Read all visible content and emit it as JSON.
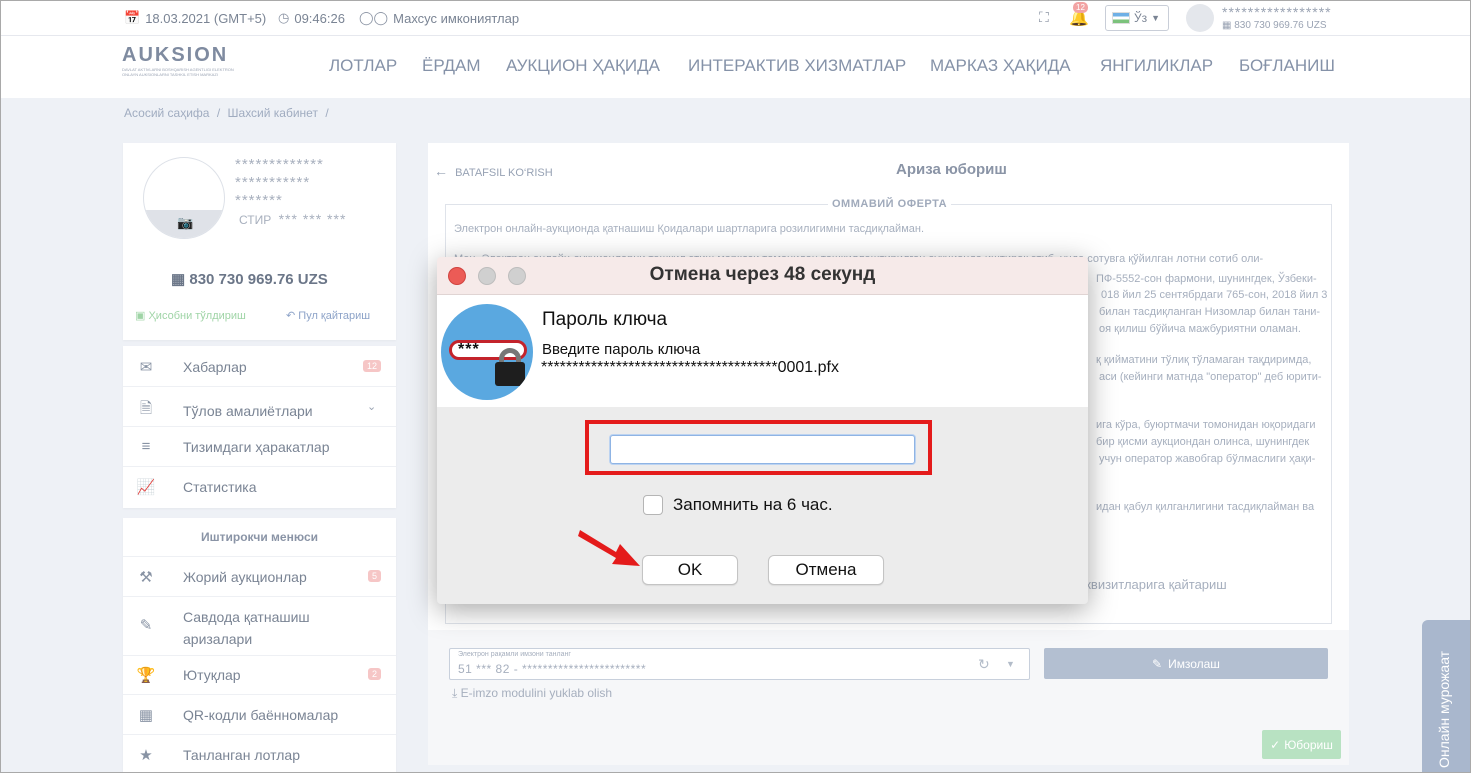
{
  "topbar": {
    "date": "18.03.2021 (GMT+5)",
    "time": "09:46:26",
    "accessibility": "Махсус имкониятлар",
    "notifications_count": "12",
    "language": "Ўз",
    "user_name": "*****************",
    "user_balance": "830 730 969.76 UZS"
  },
  "logo": {
    "text": "AUKSION",
    "subtitle": "DAVLAT AKTIVLARNI BOSHQARISH AGENTLIGI ELEKTRON ONLAYN AUKSIONLARNI TASHKIL ETISH MARKAZI"
  },
  "nav": {
    "items": [
      "ЛОТЛАР",
      "ЁРДАМ",
      "АУКЦИОН ҲАҚИДА",
      "ИНТЕРАКТИВ ХИЗМАТЛАР",
      "МАРКАЗ ҲАҚИДА",
      "ЯНГИЛИКЛАР",
      "БОҒЛАНИШ"
    ]
  },
  "breadcrumb": {
    "home": "Асосий саҳифа",
    "current": "Шахсий кабинет",
    "sep": "/"
  },
  "profile": {
    "name_line1": "*************",
    "name_line2": "***********",
    "name_line3": "*******",
    "stir_label": "СТИР",
    "stir_value": "*** *** ***",
    "balance": "830 730 969.76 UZS",
    "topup_label": "Ҳисобни тўлдириш",
    "refund_label": "Пул қайтариш"
  },
  "sidebar": {
    "items": [
      {
        "label": "Хабарлар",
        "badge": "12"
      },
      {
        "label": "Тўлов амалиётлари"
      },
      {
        "label": "Тизимдаги ҳаракатлар"
      },
      {
        "label": "Статистика"
      }
    ],
    "participant_menu_title": "Иштирокчи менюси",
    "participant_items": [
      {
        "label": "Жорий аукционлар",
        "badge": "5"
      },
      {
        "label_line1": "Савдода қатнашиш",
        "label_line2": "аризалари"
      },
      {
        "label": "Ютуқлар",
        "badge": "2"
      },
      {
        "label": "QR-кодли баённомалар"
      },
      {
        "label": "Танланган лотлар"
      }
    ]
  },
  "main": {
    "back_label": "BATAFSIL KO‘RISH",
    "title": "Ариза юбориш",
    "offer_heading": "ОММАВИЙ ОФЕРТА",
    "offer_lines": [
      "Электрон онлайн-аукционда қатнашиш Қоидалари шартларига розилигимни тасдиқлайман.",
      "Мен, Электрон онлайн-аукционларни ташкил этиш маркази томонидан ташкиллаштирилган аукционда иштирок этиб, унда сотувга қўйилган лотни сотиб оли-",
      "ПФ-5552-сон фармони, шунингдек, Ўзбеки-",
      "018 йил 25 сентябрдаги 765-сон, 2018 йил 3",
      "билан тасдиқланган Низомлар билан тани-",
      "оя қилиш бўйича мажбуриятни оламан.",
      "қ қийматини тўлиқ тўламаган тақдиримда,",
      "аси (кейинги матнда \"оператор\" деб юрити-",
      "ига кўра, буюртмачи томонидан юқоридаги",
      "бир қисми аукциондан олинса, шунингдек",
      "учун оператор жавобгар бўлмаслиги ҳақи-",
      "идан қабул қилганлигини тасдиқлайман ва",
      "еквизитларига қайтариш"
    ],
    "sign_label": "Электрон рақамли имзони танланг",
    "sign_value": "51 *** 82 -   ************************",
    "sign_button": "Имзолаш",
    "eimzo_link": "E-imzo modulini yuklab olish",
    "send_button": "Юбориш"
  },
  "side_tab": {
    "label": "Онлайн мурожаат"
  },
  "dialog": {
    "title": "Отмена через 48 секунд",
    "heading": "Пароль ключа",
    "prompt": "Введите пароль ключа",
    "key_file": "**************************************0001.pfx",
    "password_value": "",
    "pill_text": "***",
    "remember_label": "Запомнить на 6 час.",
    "ok_label": "OK",
    "cancel_label": "Отмена"
  },
  "colors": {
    "highlight_box": "#e41b1b",
    "arrow": "#e41b1b",
    "close_dot": "#ec5b56",
    "key_circle": "#5aa8e0"
  }
}
